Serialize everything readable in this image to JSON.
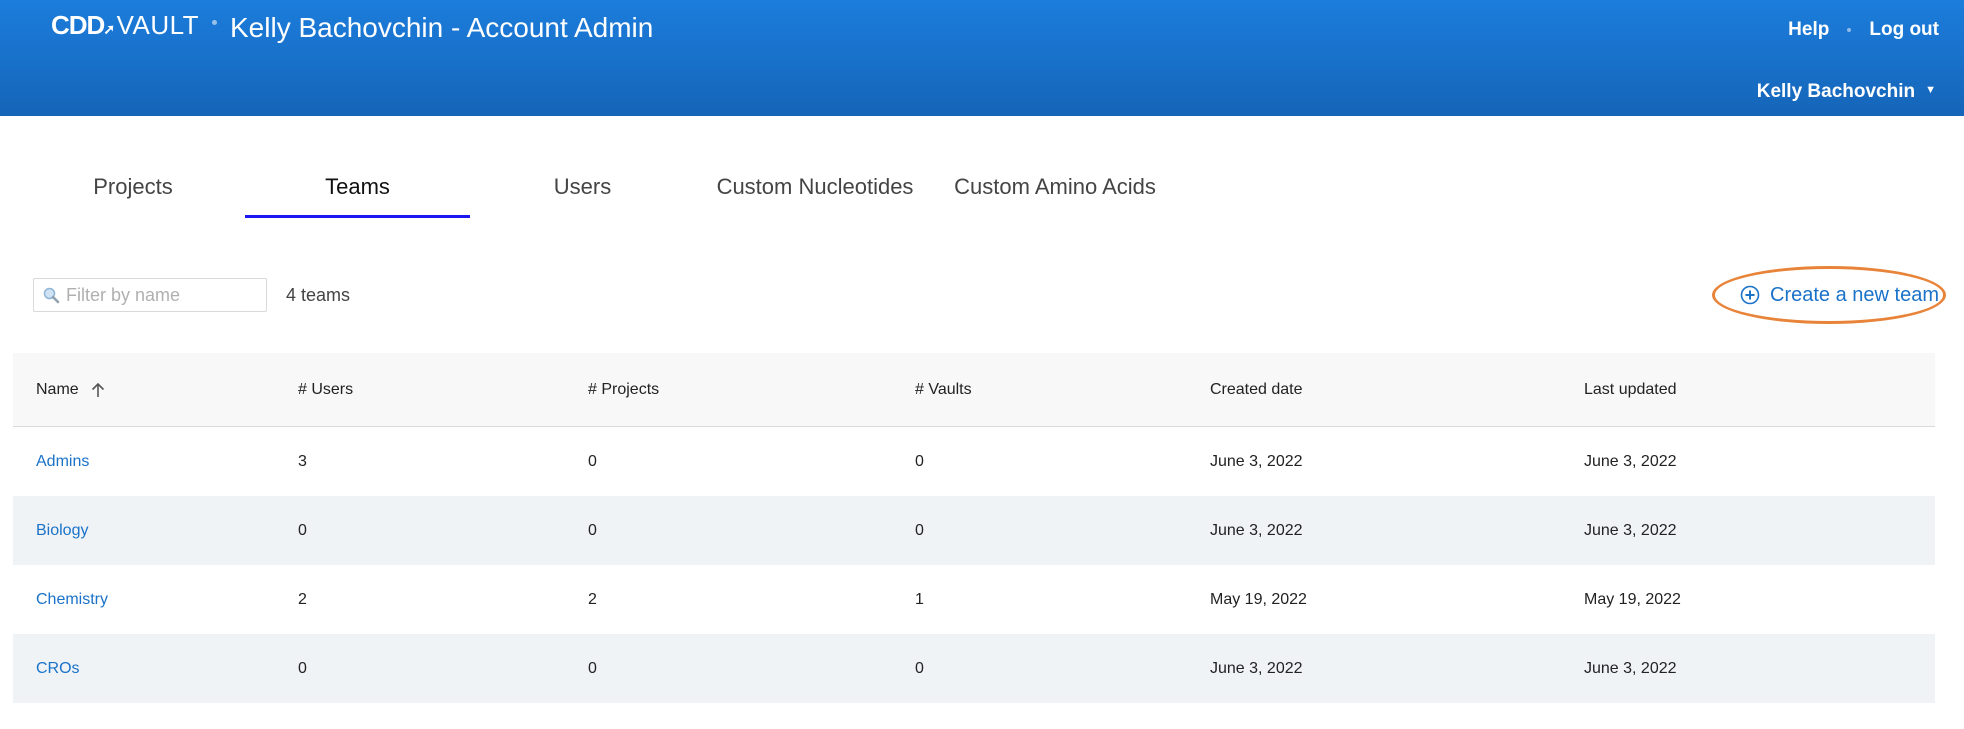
{
  "header": {
    "logo_cdd": "CDD",
    "logo_vault": "VAULT",
    "title": "Kelly Bachovchin - Account Admin",
    "help": "Help",
    "logout": "Log out",
    "user_name": "Kelly Bachovchin"
  },
  "tabs": [
    {
      "label": "Projects",
      "active": false
    },
    {
      "label": "Teams",
      "active": true
    },
    {
      "label": "Users",
      "active": false
    },
    {
      "label": "Custom Nucleotides",
      "active": false
    },
    {
      "label": "Custom Amino Acids",
      "active": false
    }
  ],
  "toolbar": {
    "filter_placeholder": "Filter by name",
    "count_label": "4 teams",
    "create_label": "Create a new team"
  },
  "table": {
    "columns": [
      "Name",
      "# Users",
      "# Projects",
      "# Vaults",
      "Created date",
      "Last updated"
    ],
    "sort_column": "Name",
    "sort_direction": "ascending",
    "rows": [
      {
        "name": "Admins",
        "users": "3",
        "projects": "0",
        "vaults": "0",
        "created": "June 3, 2022",
        "updated": "June 3, 2022"
      },
      {
        "name": "Biology",
        "users": "0",
        "projects": "0",
        "vaults": "0",
        "created": "June 3, 2022",
        "updated": "June 3, 2022"
      },
      {
        "name": "Chemistry",
        "users": "2",
        "projects": "2",
        "vaults": "1",
        "created": "May 19, 2022",
        "updated": "May 19, 2022"
      },
      {
        "name": "CROs",
        "users": "0",
        "projects": "0",
        "vaults": "0",
        "created": "June 3, 2022",
        "updated": "June 3, 2022"
      }
    ]
  },
  "colors": {
    "header_blue": "#1c7ddc",
    "link_blue": "#1a72c9",
    "tab_underline": "#1a1af0",
    "highlight_orange": "#e8843a",
    "row_alt": "#f0f3f6"
  },
  "icons": {
    "search": "magnifier-icon",
    "sort": "arrow-up-icon",
    "create": "plus-circle-icon",
    "user_menu": "caret-down-icon"
  }
}
